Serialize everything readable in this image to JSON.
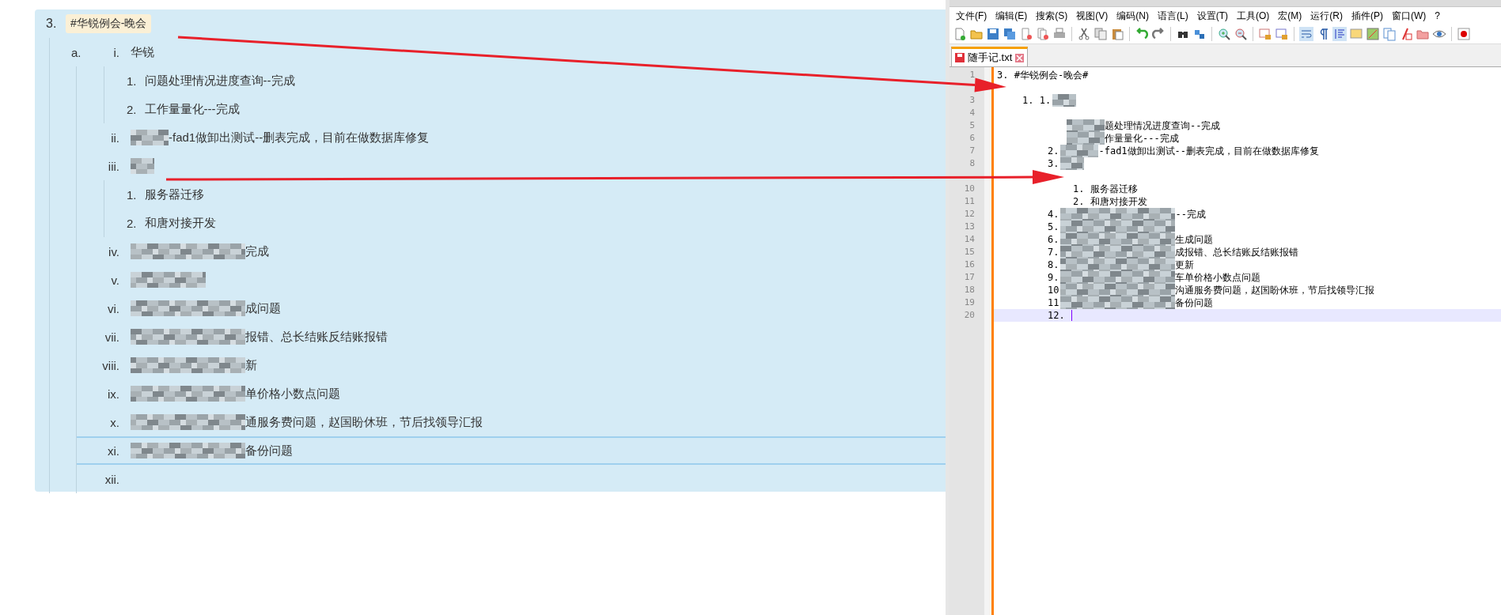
{
  "note": {
    "number": "3.",
    "tag": "#华锐例会-晚会",
    "sub_marker": "a.",
    "items": [
      {
        "marker": "i.",
        "kind": "plain",
        "text": "华锐",
        "selected": false,
        "children": [
          {
            "marker": "1.",
            "text": "问题处理情况进度查询--完成"
          },
          {
            "marker": "2.",
            "text": "工作量量化---完成"
          }
        ]
      },
      {
        "marker": "ii.",
        "kind": "short",
        "text": "-fad1做卸出测试--删表完成，目前在做数据库修复",
        "selected": false
      },
      {
        "marker": "iii.",
        "kind": "tiny",
        "selected": false,
        "children": [
          {
            "marker": "1.",
            "text": "服务器迁移"
          },
          {
            "marker": "2.",
            "text": "和唐对接开发"
          }
        ]
      },
      {
        "marker": "iv.",
        "kind": "long",
        "text": "完成",
        "selected": false
      },
      {
        "marker": "v.",
        "kind": "medium",
        "selected": false
      },
      {
        "marker": "vi.",
        "kind": "long",
        "text": "成问题",
        "selected": false
      },
      {
        "marker": "vii.",
        "kind": "long",
        "text": "报错、总长结账反结账报错",
        "selected": false
      },
      {
        "marker": "viii.",
        "kind": "long",
        "text": "新",
        "selected": false
      },
      {
        "marker": "ix.",
        "kind": "long",
        "text": "单价格小数点问题",
        "selected": false
      },
      {
        "marker": "x.",
        "kind": "long",
        "text": "通服务费问题，赵国盼休班，节后找领导汇报",
        "selected": false
      },
      {
        "marker": "xi.",
        "kind": "long",
        "text": "备份问题",
        "selected": true
      },
      {
        "marker": "xii.",
        "kind": "plain",
        "selected": false
      }
    ]
  },
  "editor": {
    "menu": [
      "文件(F)",
      "编辑(E)",
      "搜索(S)",
      "视图(V)",
      "编码(N)",
      "语言(L)",
      "设置(T)",
      "工具(O)",
      "宏(M)",
      "运行(R)",
      "插件(P)",
      "窗口(W)",
      "?"
    ],
    "tab": {
      "label": "随手记.txt"
    },
    "lines": [
      {
        "number": "1",
        "kind": "heading",
        "text": "3. #华锐例会-晚会#",
        "current": false
      },
      {
        "kind": "blank",
        "current": false
      },
      {
        "number": "3",
        "kind": "top-tiny",
        "marker": "1. 1.",
        "current": false
      },
      {
        "number": "4",
        "kind": "blank",
        "current": false
      },
      {
        "number": "5",
        "kind": "cont-short",
        "text": "题处理情况进度查询--完成",
        "current": false
      },
      {
        "number": "6",
        "kind": "cont-short",
        "text": "作量量化---完成",
        "current": false
      },
      {
        "number": "7",
        "kind": "item-short",
        "marker": "2.",
        "text": "-fad1做卸出测试--删表完成，目前在做数据库修复",
        "current": false
      },
      {
        "number": "8",
        "kind": "item-tiny",
        "marker": "3.",
        "current": false
      },
      {
        "kind": "blank",
        "current": false
      },
      {
        "number": "10",
        "kind": "sub",
        "marker": "1.",
        "text": "服务器迁移",
        "current": false
      },
      {
        "number": "11",
        "kind": "sub",
        "marker": "2.",
        "text": "和唐对接开发",
        "current": false
      },
      {
        "number": "12",
        "kind": "item-long",
        "marker": "4.",
        "text": "--完成",
        "current": false
      },
      {
        "number": "13",
        "kind": "item-long",
        "marker": "5.",
        "current": false
      },
      {
        "number": "14",
        "kind": "item-long",
        "marker": "6.",
        "text": "生成问题",
        "current": false
      },
      {
        "number": "15",
        "kind": "item-long",
        "marker": "7.",
        "text": "成报错、总长结账反结账报错",
        "current": false
      },
      {
        "number": "16",
        "kind": "item-long",
        "marker": "8.",
        "text": "更新",
        "current": false
      },
      {
        "number": "17",
        "kind": "item-long",
        "marker": "9.",
        "text": "车单价格小数点问题",
        "current": false
      },
      {
        "number": "18",
        "kind": "item-long",
        "marker": "10",
        "text": "沟通服务费问题，赵国盼休班，节后找领导汇报",
        "current": false
      },
      {
        "number": "19",
        "kind": "item-long",
        "marker": "11",
        "text": "备份问题",
        "current": false
      },
      {
        "number": "20",
        "kind": "item",
        "marker": "12.",
        "current": true
      }
    ]
  }
}
